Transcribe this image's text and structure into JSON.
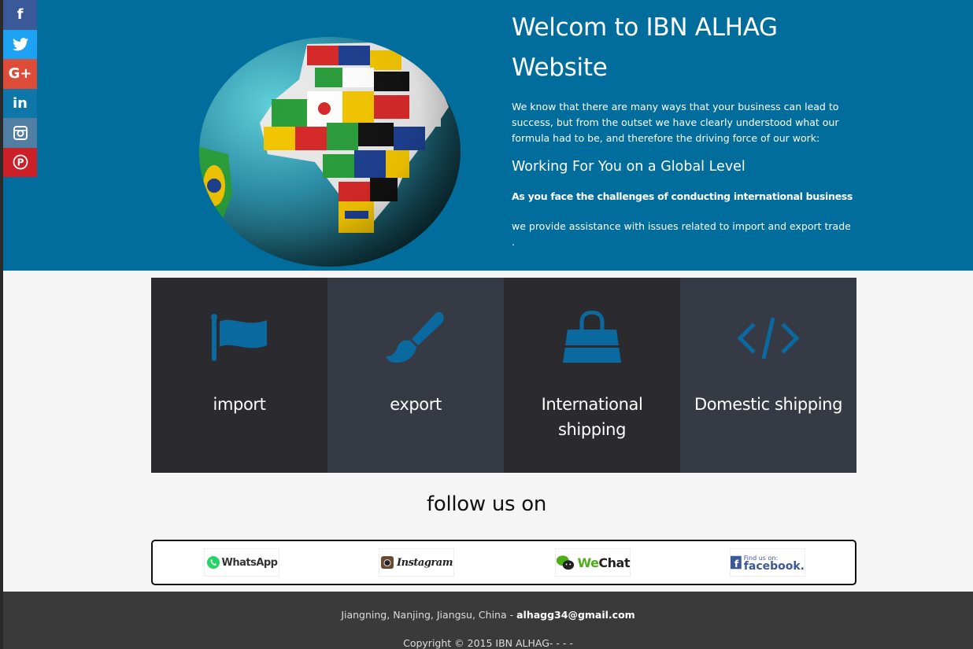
{
  "social": {
    "items": [
      {
        "name": "facebook",
        "glyph": "f",
        "color": "#3b5998"
      },
      {
        "name": "twitter",
        "glyph": "t",
        "color": "#1da1f2"
      },
      {
        "name": "google-plus",
        "glyph": "G+",
        "color": "#dd4b39"
      },
      {
        "name": "linkedin",
        "glyph": "in",
        "color": "#0e76a8"
      },
      {
        "name": "instagram",
        "glyph": "◙",
        "color": "#517fa4"
      },
      {
        "name": "pinterest",
        "glyph": "P",
        "color": "#cb2027"
      }
    ]
  },
  "hero": {
    "title": "Welcom to IBN ALHAG Website",
    "intro": "We know that there are many ways that your business can lead to success, but from the outset we have clearly understood what our formula had to be, and therefore the driving force of our work:",
    "subtitle": "Working For You on a Global Level",
    "bold_line": "As you face the challenges of conducting international business",
    "small_line": "we provide assistance with issues related to import and export trade",
    "small_line_tail": "."
  },
  "services": [
    {
      "label": "import",
      "icon": "flag-icon"
    },
    {
      "label": "export",
      "icon": "brush-icon"
    },
    {
      "label": "International shipping",
      "icon": "bag-icon"
    },
    {
      "label": "Domestic shipping",
      "icon": "code-icon"
    }
  ],
  "follow": {
    "heading": "follow us on",
    "whatsapp": "WhatsApp",
    "instagram": "Instagram",
    "wechat_we": "We",
    "wechat_chat": "Chat",
    "facebook_find": "Find us on:",
    "facebook_name": "facebook."
  },
  "footer": {
    "address": "Jiangning, Nanjing, Jiangsu, China - ",
    "email": "alhagg34@gmail.com",
    "copyright": "Copyright © 2015 IBN ALHAG- - - -"
  },
  "colors": {
    "hero_bg": "#006d9c",
    "accent_icon": "#0a6aa0",
    "service_dark": "#2b2b2f",
    "service_light": "#363a44",
    "footer_bg": "#3a3a3a"
  }
}
